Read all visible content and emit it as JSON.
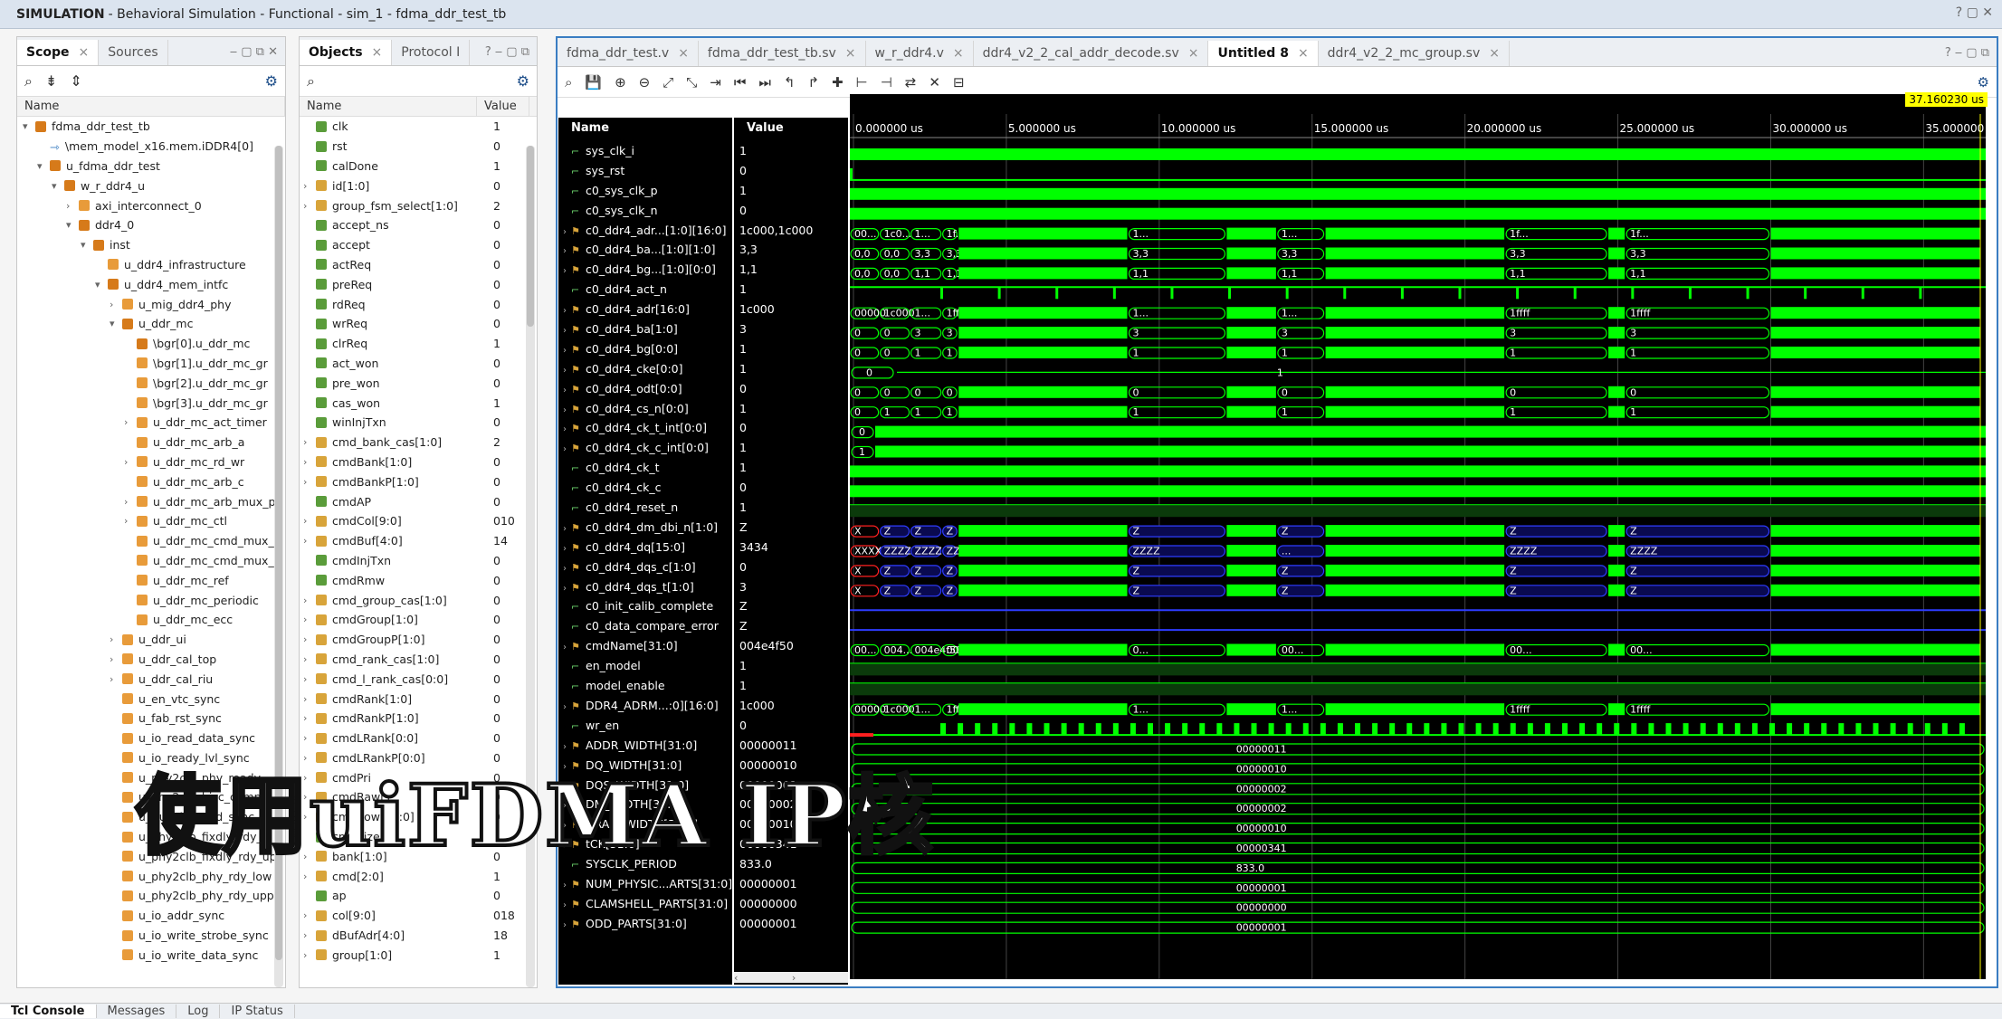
{
  "window": {
    "title_bold": "SIMULATION",
    "title": "- Behavioral Simulation - Functional - sim_1 - fdma_ddr_test_tb",
    "controls": "? ▢ ✕"
  },
  "scope": {
    "tabs": [
      "Scope",
      "Sources"
    ],
    "column": "Name",
    "rows": [
      {
        "label": "fdma_ddr_test_tb",
        "indent": 0,
        "exp": "▾",
        "icon": "mod"
      },
      {
        "label": "\\mem_model_x16.mem.iDDR4[0]",
        "indent": 1,
        "exp": "",
        "icon": "arr"
      },
      {
        "label": "u_fdma_ddr_test",
        "indent": 1,
        "exp": "▾",
        "icon": "mod"
      },
      {
        "label": "w_r_ddr4_u",
        "indent": 2,
        "exp": "▾",
        "icon": "mod"
      },
      {
        "label": "axi_interconnect_0",
        "indent": 3,
        "exp": "›",
        "icon": "inst"
      },
      {
        "label": "ddr4_0",
        "indent": 3,
        "exp": "▾",
        "icon": "mod"
      },
      {
        "label": "inst",
        "indent": 4,
        "exp": "▾",
        "icon": "mod"
      },
      {
        "label": "u_ddr4_infrastructure",
        "indent": 5,
        "exp": "",
        "icon": "inst"
      },
      {
        "label": "u_ddr4_mem_intfc",
        "indent": 5,
        "exp": "▾",
        "icon": "mod"
      },
      {
        "label": "u_mig_ddr4_phy",
        "indent": 6,
        "exp": "›",
        "icon": "inst"
      },
      {
        "label": "u_ddr_mc",
        "indent": 6,
        "exp": "▾",
        "icon": "mod"
      },
      {
        "label": "\\bgr[0].u_ddr_mc",
        "indent": 7,
        "exp": "",
        "icon": "mod"
      },
      {
        "label": "\\bgr[1].u_ddr_mc_gr",
        "indent": 7,
        "exp": "",
        "icon": "inst"
      },
      {
        "label": "\\bgr[2].u_ddr_mc_gr",
        "indent": 7,
        "exp": "",
        "icon": "inst"
      },
      {
        "label": "\\bgr[3].u_ddr_mc_gr",
        "indent": 7,
        "exp": "",
        "icon": "inst"
      },
      {
        "label": "u_ddr_mc_act_timer",
        "indent": 7,
        "exp": "›",
        "icon": "inst"
      },
      {
        "label": "u_ddr_mc_arb_a",
        "indent": 7,
        "exp": "",
        "icon": "inst"
      },
      {
        "label": "u_ddr_mc_rd_wr",
        "indent": 7,
        "exp": "›",
        "icon": "inst"
      },
      {
        "label": "u_ddr_mc_arb_c",
        "indent": 7,
        "exp": "",
        "icon": "inst"
      },
      {
        "label": "u_ddr_mc_arb_mux_p",
        "indent": 7,
        "exp": "›",
        "icon": "inst"
      },
      {
        "label": "u_ddr_mc_ctl",
        "indent": 7,
        "exp": "›",
        "icon": "inst"
      },
      {
        "label": "u_ddr_mc_cmd_mux_",
        "indent": 7,
        "exp": "",
        "icon": "inst"
      },
      {
        "label": "u_ddr_mc_cmd_mux_",
        "indent": 7,
        "exp": "",
        "icon": "inst"
      },
      {
        "label": "u_ddr_mc_ref",
        "indent": 7,
        "exp": "",
        "icon": "inst"
      },
      {
        "label": "u_ddr_mc_periodic",
        "indent": 7,
        "exp": "",
        "icon": "inst"
      },
      {
        "label": "u_ddr_mc_ecc",
        "indent": 7,
        "exp": "",
        "icon": "inst"
      },
      {
        "label": "u_ddr_ui",
        "indent": 6,
        "exp": "›",
        "icon": "inst"
      },
      {
        "label": "u_ddr_cal_top",
        "indent": 6,
        "exp": "›",
        "icon": "inst"
      },
      {
        "label": "u_ddr_cal_riu",
        "indent": 6,
        "exp": "›",
        "icon": "inst"
      },
      {
        "label": "u_en_vtc_sync",
        "indent": 6,
        "exp": "",
        "icon": "inst"
      },
      {
        "label": "u_fab_rst_sync",
        "indent": 6,
        "exp": "",
        "icon": "inst"
      },
      {
        "label": "u_io_read_data_sync",
        "indent": 6,
        "exp": "",
        "icon": "inst"
      },
      {
        "label": "u_io_ready_lvl_sync",
        "indent": 6,
        "exp": "",
        "icon": "inst"
      },
      {
        "label": "u_phy2clb_phy_ready",
        "indent": 6,
        "exp": "",
        "icon": "inst"
      },
      {
        "label": "u_phy2clb_bisc_comple",
        "indent": 6,
        "exp": "",
        "icon": "inst"
      },
      {
        "label": "u_riu2clb_valid_sync",
        "indent": 6,
        "exp": "",
        "icon": "inst"
      },
      {
        "label": "u_phy2clb_fixdly_rdy_lo",
        "indent": 6,
        "exp": "",
        "icon": "inst"
      },
      {
        "label": "u_phy2clb_fixdly_rdy_up",
        "indent": 6,
        "exp": "",
        "icon": "inst"
      },
      {
        "label": "u_phy2clb_phy_rdy_low",
        "indent": 6,
        "exp": "",
        "icon": "inst"
      },
      {
        "label": "u_phy2clb_phy_rdy_upp",
        "indent": 6,
        "exp": "",
        "icon": "inst"
      },
      {
        "label": "u_io_addr_sync",
        "indent": 6,
        "exp": "",
        "icon": "inst"
      },
      {
        "label": "u_io_write_strobe_sync",
        "indent": 6,
        "exp": "",
        "icon": "inst"
      },
      {
        "label": "u_io_write_data_sync",
        "indent": 6,
        "exp": "",
        "icon": "inst"
      }
    ]
  },
  "objects": {
    "tabs": [
      "Objects",
      "Protocol I"
    ],
    "columns": [
      "Name",
      "Value"
    ],
    "rows": [
      [
        "clk",
        "1",
        ""
      ],
      [
        "rst",
        "0",
        ""
      ],
      [
        "calDone",
        "1",
        ""
      ],
      [
        "id[1:0]",
        "0",
        "›"
      ],
      [
        "group_fsm_select[1:0]",
        "2",
        "›"
      ],
      [
        "accept_ns",
        "0",
        ""
      ],
      [
        "accept",
        "0",
        ""
      ],
      [
        "actReq",
        "0",
        ""
      ],
      [
        "preReq",
        "0",
        ""
      ],
      [
        "rdReq",
        "0",
        ""
      ],
      [
        "wrReq",
        "0",
        ""
      ],
      [
        "clrReq",
        "1",
        ""
      ],
      [
        "act_won",
        "0",
        ""
      ],
      [
        "pre_won",
        "0",
        ""
      ],
      [
        "cas_won",
        "1",
        ""
      ],
      [
        "winInjTxn",
        "0",
        ""
      ],
      [
        "cmd_bank_cas[1:0]",
        "2",
        "›"
      ],
      [
        "cmdBank[1:0]",
        "0",
        "›"
      ],
      [
        "cmdBankP[1:0]",
        "0",
        "›"
      ],
      [
        "cmdAP",
        "0",
        ""
      ],
      [
        "cmdCol[9:0]",
        "010",
        "›"
      ],
      [
        "cmdBuf[4:0]",
        "14",
        "›"
      ],
      [
        "cmdInjTxn",
        "0",
        ""
      ],
      [
        "cmdRmw",
        "0",
        ""
      ],
      [
        "cmd_group_cas[1:0]",
        "0",
        "›"
      ],
      [
        "cmdGroup[1:0]",
        "0",
        "›"
      ],
      [
        "cmdGroupP[1:0]",
        "0",
        "›"
      ],
      [
        "cmd_rank_cas[1:0]",
        "0",
        "›"
      ],
      [
        "cmd_l_rank_cas[0:0]",
        "0",
        "›"
      ],
      [
        "cmdRank[1:0]",
        "0",
        "›"
      ],
      [
        "cmdRankP[1:0]",
        "0",
        "›"
      ],
      [
        "cmdLRank[0:0]",
        "0",
        "›"
      ],
      [
        "cmdLRankP[0:0]",
        "0",
        "›"
      ],
      [
        "cmdPri",
        "0",
        "›"
      ],
      [
        "cmdRaw[1:",
        "0",
        "›"
      ],
      [
        "cmdRow[16:0]",
        "0",
        "›"
      ],
      [
        "cmdSize",
        "1",
        ""
      ],
      [
        "bank[1:0]",
        "0",
        "›"
      ],
      [
        "cmd[2:0]",
        "1",
        "›"
      ],
      [
        "ap",
        "0",
        ""
      ],
      [
        "col[9:0]",
        "018",
        "›"
      ],
      [
        "dBufAdr[4:0]",
        "18",
        "›"
      ],
      [
        "group[1:0]",
        "1",
        "›"
      ]
    ]
  },
  "editor_tabs": [
    {
      "label": "fdma_ddr_test.v",
      "active": false
    },
    {
      "label": "fdma_ddr_test_tb.sv",
      "active": false
    },
    {
      "label": "w_r_ddr4.v",
      "active": false
    },
    {
      "label": "ddr4_v2_2_cal_addr_decode.sv",
      "active": false
    },
    {
      "label": "Untitled 8",
      "active": true
    },
    {
      "label": "ddr4_v2_2_mc_group.sv",
      "active": false
    }
  ],
  "wave": {
    "name_header": "Name",
    "value_header": "Value",
    "cursor_time": "37.160230 us",
    "time_ticks": [
      "0.000000 us",
      "5.000000 us",
      "10.000000 us",
      "15.000000 us",
      "20.000000 us",
      "25.000000 us",
      "30.000000 us",
      "35.000000"
    ],
    "signals": [
      {
        "name": "sys_clk_i",
        "value": "1",
        "kind": "clk",
        "exp": ""
      },
      {
        "name": "sys_rst",
        "value": "0",
        "kind": "low",
        "exp": ""
      },
      {
        "name": "c0_sys_clk_p",
        "value": "1",
        "kind": "clk",
        "exp": ""
      },
      {
        "name": "c0_sys_clk_n",
        "value": "0",
        "kind": "clk",
        "exp": ""
      },
      {
        "name": "c0_ddr4_adr...[1:0][16:0]",
        "value": "1c000,1c000",
        "kind": "busx",
        "exp": "›",
        "labels": [
          "00...",
          "1c0...",
          "1...",
          "1f...",
          "1...",
          "1...",
          "1f...",
          "1f...",
          "1...",
          "1..."
        ]
      },
      {
        "name": "c0_ddr4_ba...[1:0][1:0]",
        "value": "3,3",
        "kind": "busx",
        "exp": "›",
        "labels": [
          "0,0",
          "0,0",
          "3,3",
          "3,3",
          "3,3",
          "3,3",
          "3,3",
          "3,3",
          "3,3",
          "3,3"
        ]
      },
      {
        "name": "c0_ddr4_bg...[1:0][0:0]",
        "value": "1,1",
        "kind": "busx",
        "exp": "›",
        "labels": [
          "0,0",
          "0,0",
          "1,1",
          "1,1",
          "1,1",
          "1,1",
          "1,1",
          "1,1",
          "1,1",
          "1,1"
        ]
      },
      {
        "name": "c0_ddr4_act_n",
        "value": "1",
        "kind": "sparse",
        "exp": ""
      },
      {
        "name": "c0_ddr4_adr[16:0]",
        "value": "1c000",
        "kind": "busx",
        "exp": "›",
        "labels": [
          "00000",
          "1c000",
          "1...",
          "1ffff",
          "1...",
          "1...",
          "1ffff",
          "1ffff",
          "1...",
          "1..."
        ]
      },
      {
        "name": "c0_ddr4_ba[1:0]",
        "value": "3",
        "kind": "busx",
        "exp": "›",
        "labels": [
          "0",
          "0",
          "3",
          "3",
          "3",
          "3",
          "3",
          "3",
          "3",
          "3"
        ]
      },
      {
        "name": "c0_ddr4_bg[0:0]",
        "value": "1",
        "kind": "busx",
        "exp": "›",
        "labels": [
          "0",
          "0",
          "1",
          "1",
          "1",
          "1",
          "1",
          "1",
          "1",
          "1"
        ]
      },
      {
        "name": "c0_ddr4_cke[0:0]",
        "value": "1",
        "kind": "cke",
        "exp": "›",
        "labels": [
          "0",
          "1"
        ]
      },
      {
        "name": "c0_ddr4_odt[0:0]",
        "value": "0",
        "kind": "busx",
        "exp": "›",
        "labels": [
          "0",
          "0",
          "0",
          "0",
          "0",
          "0",
          "0",
          "0",
          "0",
          "0"
        ]
      },
      {
        "name": "c0_ddr4_cs_n[0:0]",
        "value": "1",
        "kind": "busx",
        "exp": "›",
        "labels": [
          "0",
          "1",
          "1",
          "1",
          "1",
          "1",
          "1",
          "1",
          "1",
          "1"
        ]
      },
      {
        "name": "c0_ddr4_ck_t_int[0:0]",
        "value": "0",
        "kind": "clkbus",
        "exp": "›",
        "labels": [
          "0"
        ]
      },
      {
        "name": "c0_ddr4_ck_c_int[0:0]",
        "value": "1",
        "kind": "clkbus",
        "exp": "›",
        "labels": [
          "1"
        ]
      },
      {
        "name": "c0_ddr4_ck_t",
        "value": "1",
        "kind": "clk",
        "exp": ""
      },
      {
        "name": "c0_ddr4_ck_c",
        "value": "0",
        "kind": "clk",
        "exp": ""
      },
      {
        "name": "c0_ddr4_reset_n",
        "value": "1",
        "kind": "high",
        "exp": ""
      },
      {
        "name": "c0_ddr4_dm_dbi_n[1:0]",
        "value": "Z",
        "kind": "busz",
        "exp": "›",
        "labels": [
          "X",
          "Z",
          "Z",
          "Z",
          "Z",
          "Z",
          "Z",
          "Z",
          "Z",
          "Z"
        ]
      },
      {
        "name": "c0_ddr4_dq[15:0]",
        "value": "3434",
        "kind": "busz",
        "exp": "›",
        "labels": [
          "XXXX",
          "ZZZZ",
          "ZZZZ",
          "ZZZZ",
          "ZZZZ",
          "...",
          "ZZZZ",
          "ZZZZ",
          "ZZZZ",
          "ZZZZ"
        ]
      },
      {
        "name": "c0_ddr4_dqs_c[1:0]",
        "value": "0",
        "kind": "busz",
        "exp": "›",
        "labels": [
          "X",
          "Z",
          "Z",
          "Z",
          "Z",
          "Z",
          "Z",
          "Z",
          "Z",
          "Z"
        ]
      },
      {
        "name": "c0_ddr4_dqs_t[1:0]",
        "value": "3",
        "kind": "busz",
        "exp": "›",
        "labels": [
          "X",
          "Z",
          "Z",
          "Z",
          "Z",
          "Z",
          "Z",
          "Z",
          "Z",
          "Z"
        ]
      },
      {
        "name": "c0_init_calib_complete",
        "value": "Z",
        "kind": "z",
        "exp": ""
      },
      {
        "name": "c0_data_compare_error",
        "value": "Z",
        "kind": "z",
        "exp": ""
      },
      {
        "name": "cmdName[31:0]",
        "value": "004e4f50",
        "kind": "busx",
        "exp": "›",
        "labels": [
          "00...",
          "004...",
          "004e4f50",
          "00...",
          "0...",
          "00...",
          "00...",
          "00...",
          "0...",
          "0..."
        ]
      },
      {
        "name": "en_model",
        "value": "1",
        "kind": "high",
        "exp": ""
      },
      {
        "name": "model_enable",
        "value": "1",
        "kind": "high",
        "exp": ""
      },
      {
        "name": "DDR4_ADRM...:0][16:0]",
        "value": "1c000",
        "kind": "busx",
        "exp": "›",
        "labels": [
          "00000",
          "1c000",
          "1...",
          "1ffff",
          "1...",
          "1...",
          "1ffff",
          "1ffff",
          "1...",
          "1..."
        ]
      },
      {
        "name": "wr_en",
        "value": "0",
        "kind": "pulse",
        "exp": ""
      },
      {
        "name": "ADDR_WIDTH[31:0]",
        "value": "00000011",
        "kind": "const",
        "exp": "›",
        "labels": [
          "00000011"
        ]
      },
      {
        "name": "DQ_WIDTH[31:0]",
        "value": "00000010",
        "kind": "const",
        "exp": "›",
        "labels": [
          "00000010"
        ]
      },
      {
        "name": "DQS_WIDTH[31:0]",
        "value": "00000002",
        "kind": "const",
        "exp": "›",
        "labels": [
          "00000002"
        ]
      },
      {
        "name": "DM_WIDTH[31:0]",
        "value": "00000002",
        "kind": "const",
        "exp": "›",
        "labels": [
          "00000002"
        ]
      },
      {
        "name": "DRAM_WIDTH[31:0]",
        "value": "00000010",
        "kind": "const",
        "exp": "›",
        "labels": [
          "00000010"
        ]
      },
      {
        "name": "tCK[31:0]",
        "value": "00000341",
        "kind": "const",
        "exp": "›",
        "labels": [
          "00000341"
        ]
      },
      {
        "name": "SYSCLK_PERIOD",
        "value": "833.0",
        "kind": "const",
        "exp": "",
        "labels": [
          "833.0"
        ]
      },
      {
        "name": "NUM_PHYSIC...ARTS[31:0]",
        "value": "00000001",
        "kind": "const",
        "exp": "›",
        "labels": [
          "00000001"
        ]
      },
      {
        "name": "CLAMSHELL_PARTS[31:0]",
        "value": "00000000",
        "kind": "const",
        "exp": "›",
        "labels": [
          "00000000"
        ]
      },
      {
        "name": "ODD_PARTS[31:0]",
        "value": "00000001",
        "kind": "const",
        "exp": "›",
        "labels": [
          "00000001"
        ]
      }
    ]
  },
  "bottom_tabs": [
    "Tcl Console",
    "Messages",
    "Log",
    "IP Status"
  ],
  "overlay_text": "使用uiFDMA IP核",
  "colors": {
    "wave_green": "#00ff00",
    "wave_blue": "#2e3cff",
    "wave_red": "#ff2020",
    "accent": "#1f4f8a"
  }
}
